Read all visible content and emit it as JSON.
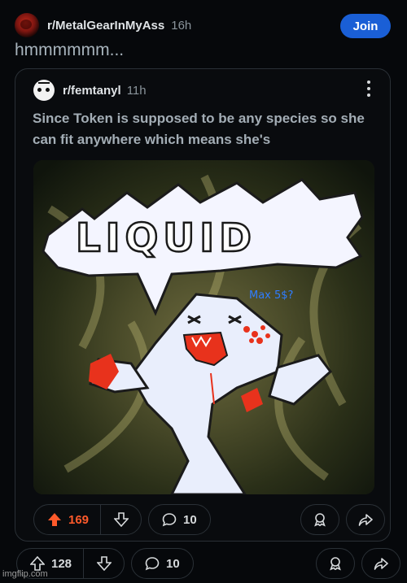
{
  "post": {
    "subreddit": "r/MetalGearInMyAss",
    "time": "16h",
    "join_label": "Join",
    "title": "hmmmmmm...",
    "upvotes": "128",
    "comments": "10"
  },
  "crosspost": {
    "subreddit": "r/femtanyl",
    "time": "11h",
    "title": "Since Token is supposed to be any species so she can fit anywhere which means she's",
    "image_text": "LIQUID",
    "signature": "Max 5$?",
    "upvotes": "169",
    "comments": "10"
  },
  "watermark": "imgflip.com",
  "colors": {
    "background": "#06080b",
    "join_button": "#1a5fd6",
    "upvote_active": "#ff5a2b",
    "border": "#2a3036"
  },
  "icons": [
    "upvote-icon",
    "downvote-icon",
    "comment-icon",
    "award-icon",
    "share-icon",
    "more-options-icon"
  ]
}
